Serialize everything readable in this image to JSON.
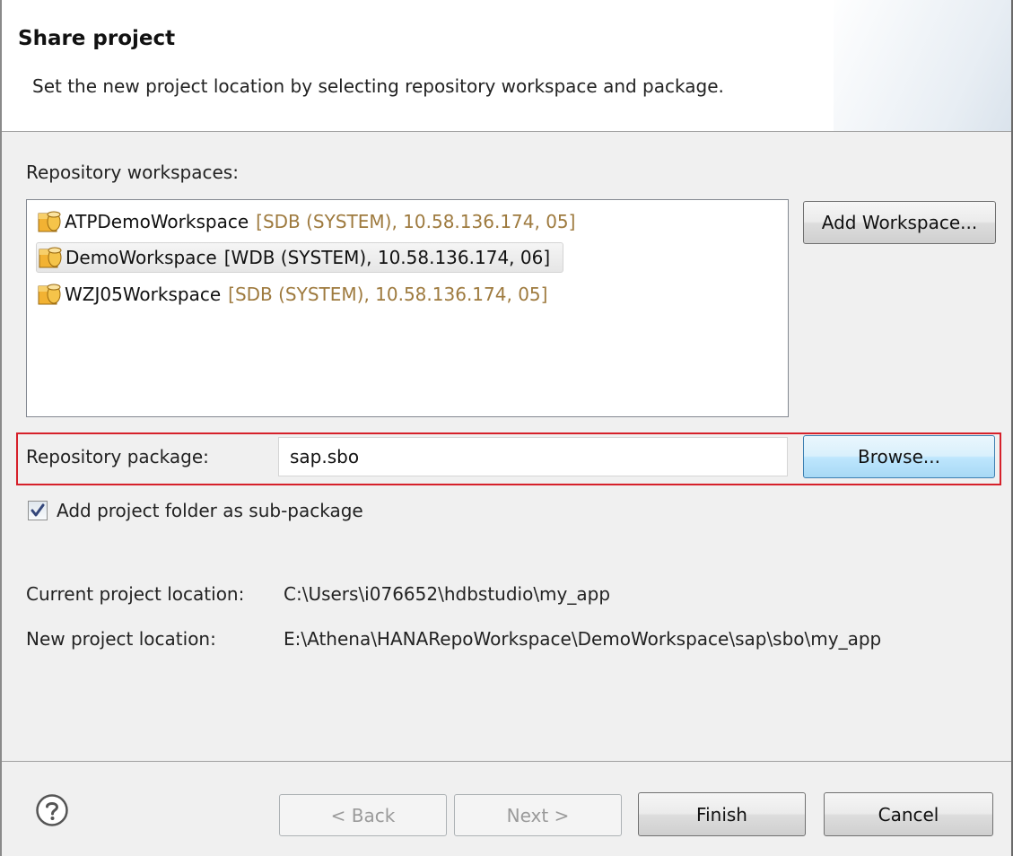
{
  "header": {
    "title": "Share project",
    "subtitle": "Set the new project location by selecting repository workspace and package."
  },
  "workspaces": {
    "label": "Repository workspaces:",
    "items": [
      {
        "name": "ATPDemoWorkspace",
        "detail": "[SDB (SYSTEM), 10.58.136.174,  05]",
        "selected": false
      },
      {
        "name": "DemoWorkspace",
        "detail": "[WDB (SYSTEM), 10.58.136.174,  06]",
        "selected": true
      },
      {
        "name": "WZJ05Workspace",
        "detail": "[SDB (SYSTEM), 10.58.136.174,  05]",
        "selected": false
      }
    ],
    "add_button": "Add Workspace..."
  },
  "package": {
    "label": "Repository package:",
    "value": "sap.sbo",
    "browse_button": "Browse..."
  },
  "subpackage": {
    "label": "Add project folder as sub-package",
    "checked": true
  },
  "locations": {
    "current_label": "Current project location:",
    "current_value": "C:\\Users\\i076652\\hdbstudio\\my_app",
    "new_label": "New project location:",
    "new_value": "E:\\Athena\\HANARepoWorkspace\\DemoWorkspace\\sap\\sbo\\my_app"
  },
  "footer": {
    "back_button": "< Back",
    "next_button": "Next >",
    "finish_button": "Finish",
    "cancel_button": "Cancel"
  },
  "icons": {
    "workspace": "database-icon",
    "help": "help-icon",
    "checkbox": "checkmark-icon"
  },
  "colors": {
    "highlight": "#d6202a",
    "detail_text": "#9e7a3e",
    "focus_border": "#3c7fb1"
  }
}
